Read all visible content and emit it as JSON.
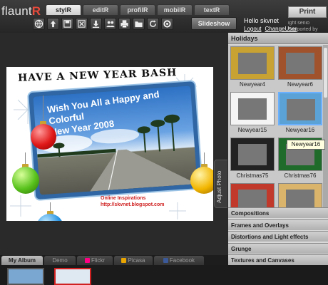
{
  "app": {
    "logo_text": "flaunt",
    "logo_accent": "R"
  },
  "tabs": [
    {
      "label": "stylR",
      "active": true
    },
    {
      "label": "editR",
      "active": false
    },
    {
      "label": "profilR",
      "active": false
    },
    {
      "label": "mobilR",
      "active": false
    },
    {
      "label": "textR",
      "active": false
    }
  ],
  "toolbar": {
    "icons": [
      "globe-icon",
      "upload-icon",
      "save-icon",
      "close-icon",
      "download-icon",
      "share-icon",
      "print-icon",
      "folder-icon",
      "refresh-icon",
      "settings-icon"
    ],
    "slideshow_label": "Slideshow"
  },
  "user": {
    "greeting": "Hello skvnet",
    "logout": "Logout",
    "change_user": "ChangeUser"
  },
  "print_button": "Print",
  "overlay_text": "ight senio Supported by Fiona",
  "card": {
    "headline": "HAVE A NEW YEAR BASH",
    "greeting_lines": [
      "Wish You All a Happy and",
      "Colorful",
      "New Year 2008"
    ],
    "credit_lines": [
      "Online Inspirations",
      "http://skvnet.blogspot.com"
    ]
  },
  "adjust_photo_label": "Adjust Photo",
  "right_panel": {
    "header": "Holidays",
    "thumbnails": [
      {
        "label": "Newyear4",
        "color": "#c8a232"
      },
      {
        "label": "Newyear6",
        "color": "#a0522d"
      },
      {
        "label": "Newyear15",
        "color": "#f4f4f4"
      },
      {
        "label": "Newyear16",
        "color": "#5ba3d6"
      },
      {
        "label": "Christmas75",
        "color": "#222222"
      },
      {
        "label": "Christmas76",
        "color": "#1f6b2a"
      },
      {
        "label": "",
        "color": "#c0392b"
      },
      {
        "label": "",
        "color": "#d9b46a"
      }
    ],
    "tooltip": "Newyear16",
    "categories": [
      "Compositions",
      "Frames and Overlays",
      "Distortions and Light effects",
      "Grunge",
      "Textures and Canvases"
    ]
  },
  "bottom_tabs": [
    {
      "label": "My Album",
      "active": true,
      "icon": ""
    },
    {
      "label": "Demo",
      "active": false,
      "icon": ""
    },
    {
      "label": "Flickr",
      "active": false,
      "icon": "flickr-icon"
    },
    {
      "label": "Picasa",
      "active": false,
      "icon": "picasa-icon"
    },
    {
      "label": "Facebook",
      "active": false,
      "icon": "facebook-icon"
    }
  ]
}
